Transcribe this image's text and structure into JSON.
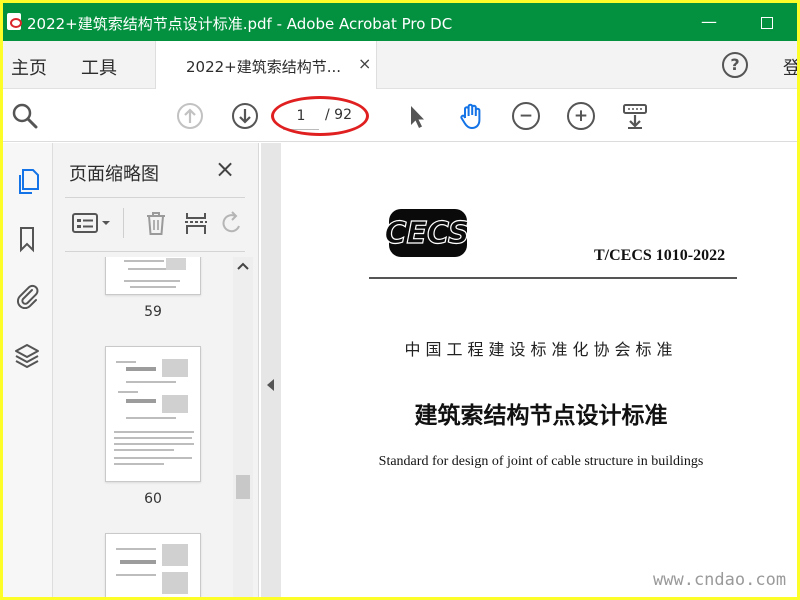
{
  "window": {
    "title": "2022+建筑索结构节点设计标准.pdf - Adobe Acrobat Pro DC",
    "minimize_glyph": "—",
    "maximize_glyph": "☐"
  },
  "menu": {
    "home": "主页",
    "tools": "工具",
    "tab_label": "2022+建筑索结构节...",
    "tab_close": "×",
    "help": "?",
    "signin": "登"
  },
  "toolbar": {
    "current_page": "1",
    "total_pages": "/ 92"
  },
  "thumbnails_panel": {
    "title": "页面缩略图",
    "close": "×",
    "pages": [
      {
        "label": "59"
      },
      {
        "label": "60"
      },
      {
        "label": ""
      }
    ]
  },
  "document": {
    "logo_text": "CECS",
    "standard_code": "T/CECS 1010-2022",
    "organization": "中国工程建设标准化协会标准",
    "title": "建筑索结构节点设计标准",
    "subtitle": "Standard for design of joint of cable structure in buildings"
  },
  "overlay": {
    "watermark": "www.cndao.com",
    "highlight_color": "#e02020"
  },
  "colors": {
    "titlebar": "#03913f",
    "border": "#fdfd2a",
    "active_tool": "#1473e6"
  }
}
